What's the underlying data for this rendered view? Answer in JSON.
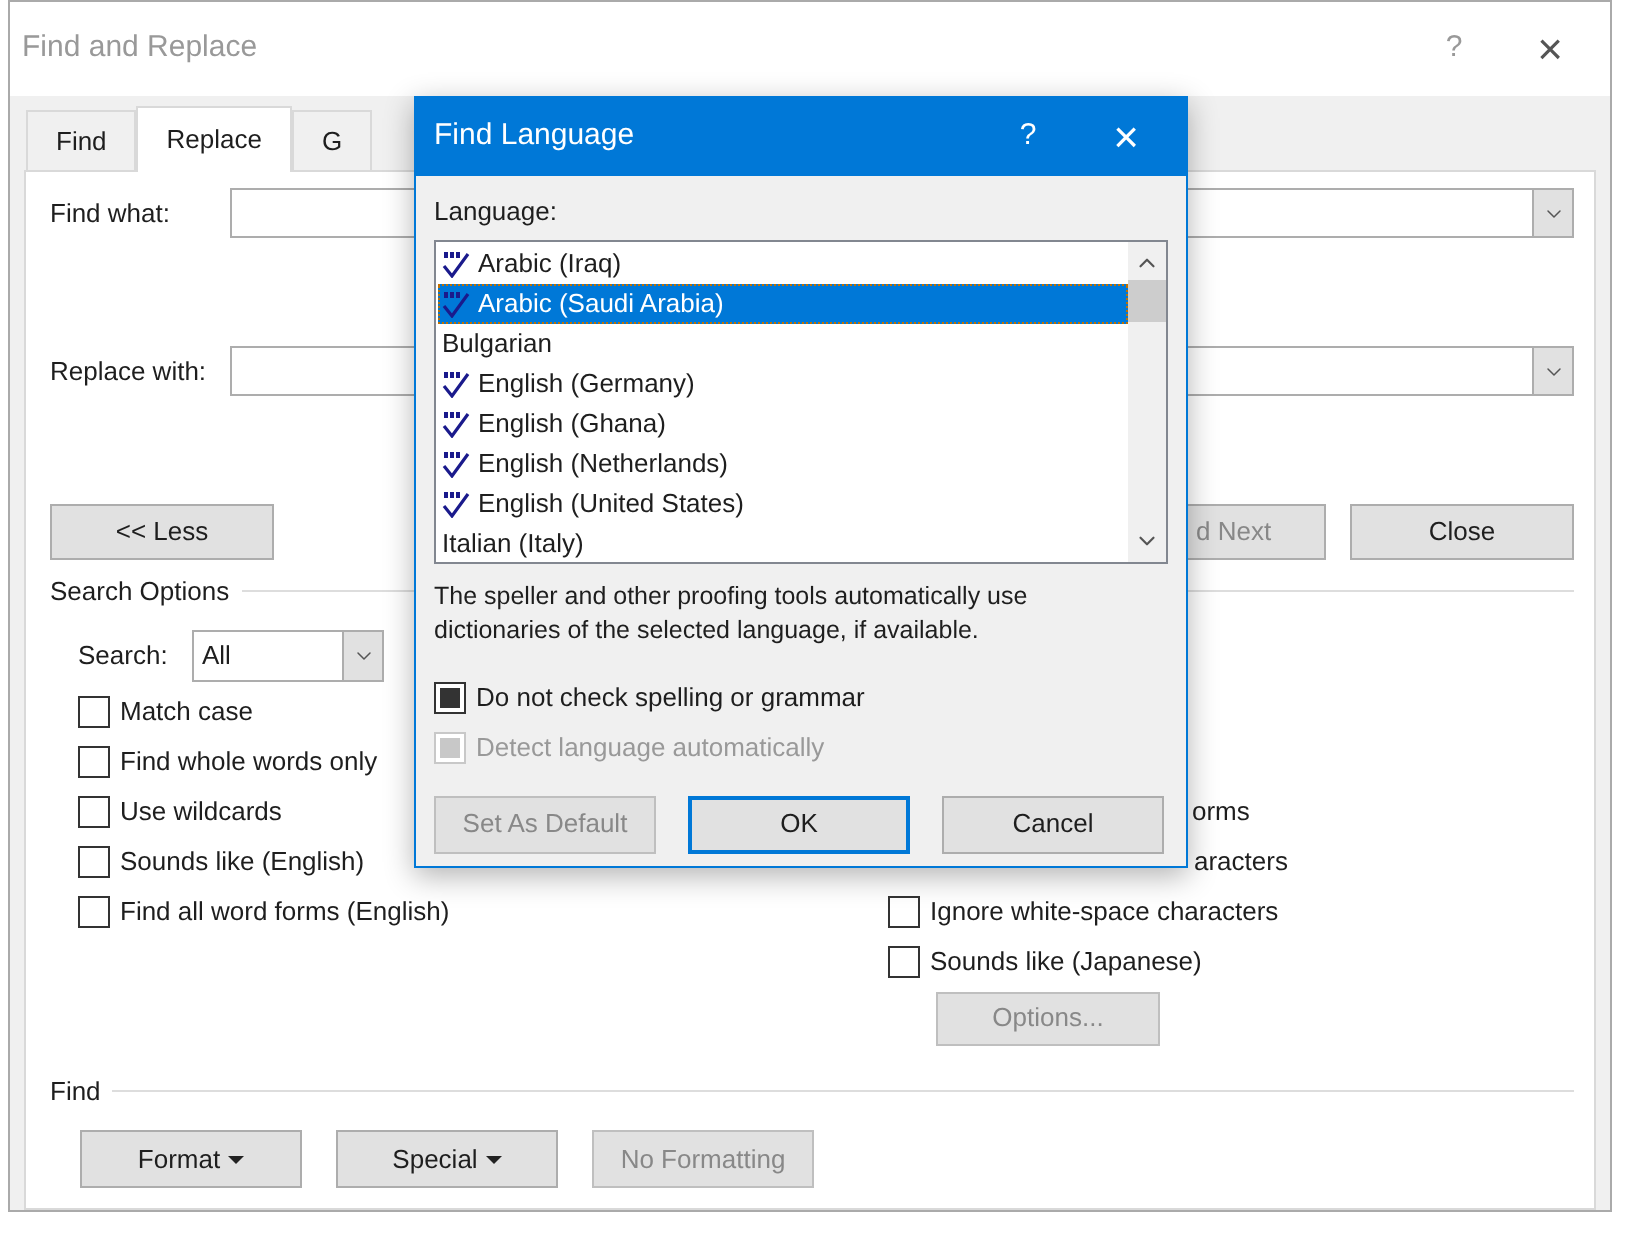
{
  "window": {
    "title": "Find and Replace",
    "help": "?",
    "close": "×"
  },
  "tabs": [
    {
      "label": "Find",
      "selected": false
    },
    {
      "label": "Replace",
      "selected": true
    },
    {
      "label": "G",
      "selected": false
    }
  ],
  "find_what": {
    "label": "Find what:"
  },
  "replace_with": {
    "label": "Replace with:"
  },
  "less_button": "<< Less",
  "find_next_button": "d Next",
  "close_button": "Close",
  "search_options": {
    "heading": "Search Options",
    "search_label": "Search:",
    "search_value": "All",
    "left_options": [
      {
        "label": "Match case",
        "checked": false
      },
      {
        "label": "Find whole words only",
        "checked": false
      },
      {
        "label": "Use wildcards",
        "checked": false
      },
      {
        "label": "Sounds like (English)",
        "checked": false
      },
      {
        "label": "Find all word forms (English)",
        "checked": false
      }
    ],
    "right_options": [
      {
        "kind": "partial",
        "label": "orms"
      },
      {
        "kind": "partial",
        "label": "aracters"
      },
      {
        "kind": "checkbox",
        "label": "Ignore white-space characters",
        "checked": false
      },
      {
        "kind": "checkbox",
        "label": "Sounds like (Japanese)",
        "checked": false
      }
    ],
    "options_button": {
      "label": "Options...",
      "disabled": true
    }
  },
  "find_section": {
    "heading": "Find",
    "buttons": [
      {
        "label": "Format",
        "dropdown": true,
        "disabled": false
      },
      {
        "label": "Special",
        "dropdown": true,
        "disabled": false
      },
      {
        "label": "No Formatting",
        "dropdown": false,
        "disabled": true
      }
    ]
  },
  "language_dialog": {
    "title": "Find Language",
    "help": "?",
    "close": "×",
    "list_label": "Language:",
    "languages": [
      {
        "name": "Arabic (Iraq)",
        "proofing": true,
        "selected": false
      },
      {
        "name": "Arabic (Saudi Arabia)",
        "proofing": true,
        "selected": true
      },
      {
        "name": "Bulgarian",
        "proofing": false,
        "selected": false
      },
      {
        "name": "English (Germany)",
        "proofing": true,
        "selected": false
      },
      {
        "name": "English (Ghana)",
        "proofing": true,
        "selected": false
      },
      {
        "name": "English (Netherlands)",
        "proofing": true,
        "selected": false
      },
      {
        "name": "English (United States)",
        "proofing": true,
        "selected": false
      },
      {
        "name": "Italian (Italy)",
        "proofing": false,
        "selected": false
      }
    ],
    "note": "The speller and other proofing tools automatically use dictionaries of the selected language, if available.",
    "options": [
      {
        "label": "Do not check spelling or grammar",
        "checked": true,
        "disabled": false
      },
      {
        "label": "Detect language automatically",
        "checked": true,
        "disabled": true
      }
    ],
    "buttons": [
      {
        "label": "Set As Default",
        "disabled": true,
        "default": false
      },
      {
        "label": "OK",
        "disabled": false,
        "default": true
      },
      {
        "label": "Cancel",
        "disabled": false,
        "default": false
      }
    ]
  }
}
